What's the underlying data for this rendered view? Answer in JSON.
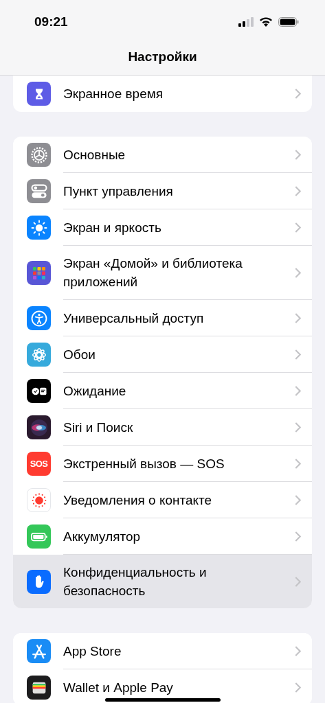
{
  "status_bar": {
    "time": "09:21"
  },
  "nav": {
    "title": "Настройки"
  },
  "groups": [
    {
      "items": [
        {
          "label": "Экранное время",
          "kind": "hourglass",
          "selected": false
        }
      ]
    },
    {
      "items": [
        {
          "label": "Основные",
          "kind": "gear",
          "selected": false
        },
        {
          "label": "Пункт управления",
          "kind": "toggles",
          "selected": false
        },
        {
          "label": "Экран и яркость",
          "kind": "sun",
          "selected": false
        },
        {
          "label": "Экран «Домой» и библиотека приложений",
          "kind": "grid",
          "selected": false
        },
        {
          "label": "Универсальный доступ",
          "kind": "accessibility",
          "selected": false
        },
        {
          "label": "Обои",
          "kind": "flower",
          "selected": false
        },
        {
          "label": "Ожидание",
          "kind": "standby",
          "selected": false
        },
        {
          "label": "Siri и Поиск",
          "kind": "siri",
          "selected": false
        },
        {
          "label": "Экстренный вызов — SOS",
          "kind": "sos",
          "icon_text": "SOS",
          "selected": false
        },
        {
          "label": "Уведомления о контакте",
          "kind": "exposure",
          "selected": false
        },
        {
          "label": "Аккумулятор",
          "kind": "battery",
          "selected": false
        },
        {
          "label": "Конфиденциальность и безопасность",
          "kind": "hand",
          "selected": true
        }
      ]
    },
    {
      "items": [
        {
          "label": "App Store",
          "kind": "appstore",
          "selected": false
        },
        {
          "label": "Wallet и Apple Pay",
          "kind": "wallet",
          "selected": false
        }
      ]
    }
  ]
}
